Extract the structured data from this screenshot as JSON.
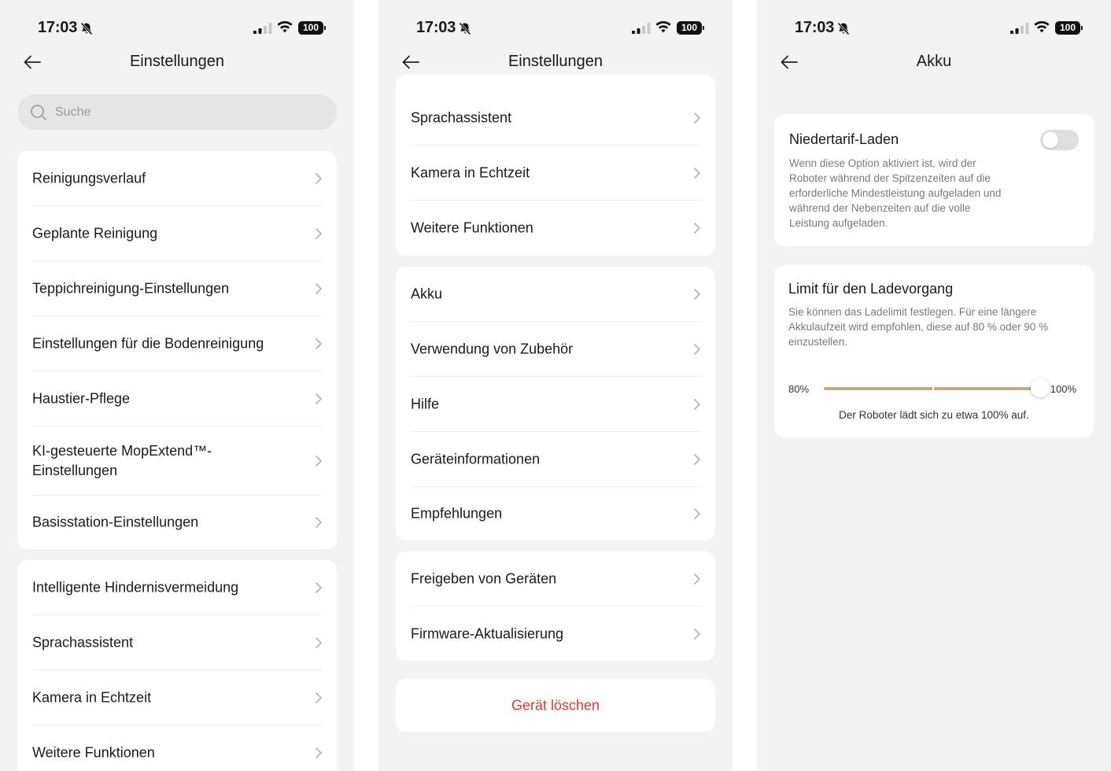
{
  "status_bar": {
    "time": "17:03",
    "battery": "100"
  },
  "screen1": {
    "title": "Einstellungen",
    "search_placeholder": "Suche",
    "group1": [
      "Reinigungsverlauf",
      "Geplante Reinigung",
      "Teppichreinigung-Einstellungen",
      "Einstellungen für die Bodenreinigung",
      "Haustier-Pflege",
      "KI-gesteuerte MopExtend™-Einstellungen",
      "Basisstation-Einstellungen"
    ],
    "group2": [
      "Intelligente Hindernisvermeidung",
      "Sprachassistent",
      "Kamera in Echtzeit",
      "Weitere Funktionen"
    ]
  },
  "screen2": {
    "title": "Einstellungen",
    "group1": [
      "Sprachassistent",
      "Kamera in Echtzeit",
      "Weitere Funktionen"
    ],
    "group2": [
      "Akku",
      "Verwendung von Zubehör",
      "Hilfe",
      "Geräteinformationen",
      "Empfehlungen"
    ],
    "group3": [
      "Freigeben von Geräten",
      "Firmware-Aktualisierung"
    ],
    "delete_label": "Gerät löschen"
  },
  "screen3": {
    "title": "Akku",
    "off_peak": {
      "title": "Niedertarif-Laden",
      "description": "Wenn diese Option aktiviert ist, wird der Roboter während der Spitzenzeiten auf die erforderliche Mindestleistung aufgeladen und während der Nebenzeiten auf die volle Leistung aufgeladen.",
      "enabled": false
    },
    "charge_limit": {
      "title": "Limit für den Ladevorgang",
      "description": "Sie können das Ladelimit festlegen. Für eine längere Akkulaufzeit wird empfohlen, diese auf 80 % oder 90 % einzustellen.",
      "min_label": "80%",
      "max_label": "100%",
      "value_fraction": 1.0,
      "caption": "Der Roboter lädt sich zu etwa 100% auf."
    }
  },
  "colors": {
    "background": "#f3f3f3",
    "card": "#ffffff",
    "danger": "#e8372c",
    "slider_track": "#c4a783",
    "toggle_off": "#dedede"
  },
  "icons": [
    "back-arrow-icon",
    "search-icon",
    "chevron-right-icon",
    "bell-slash-icon",
    "signal-icon",
    "wifi-icon",
    "battery-icon"
  ]
}
